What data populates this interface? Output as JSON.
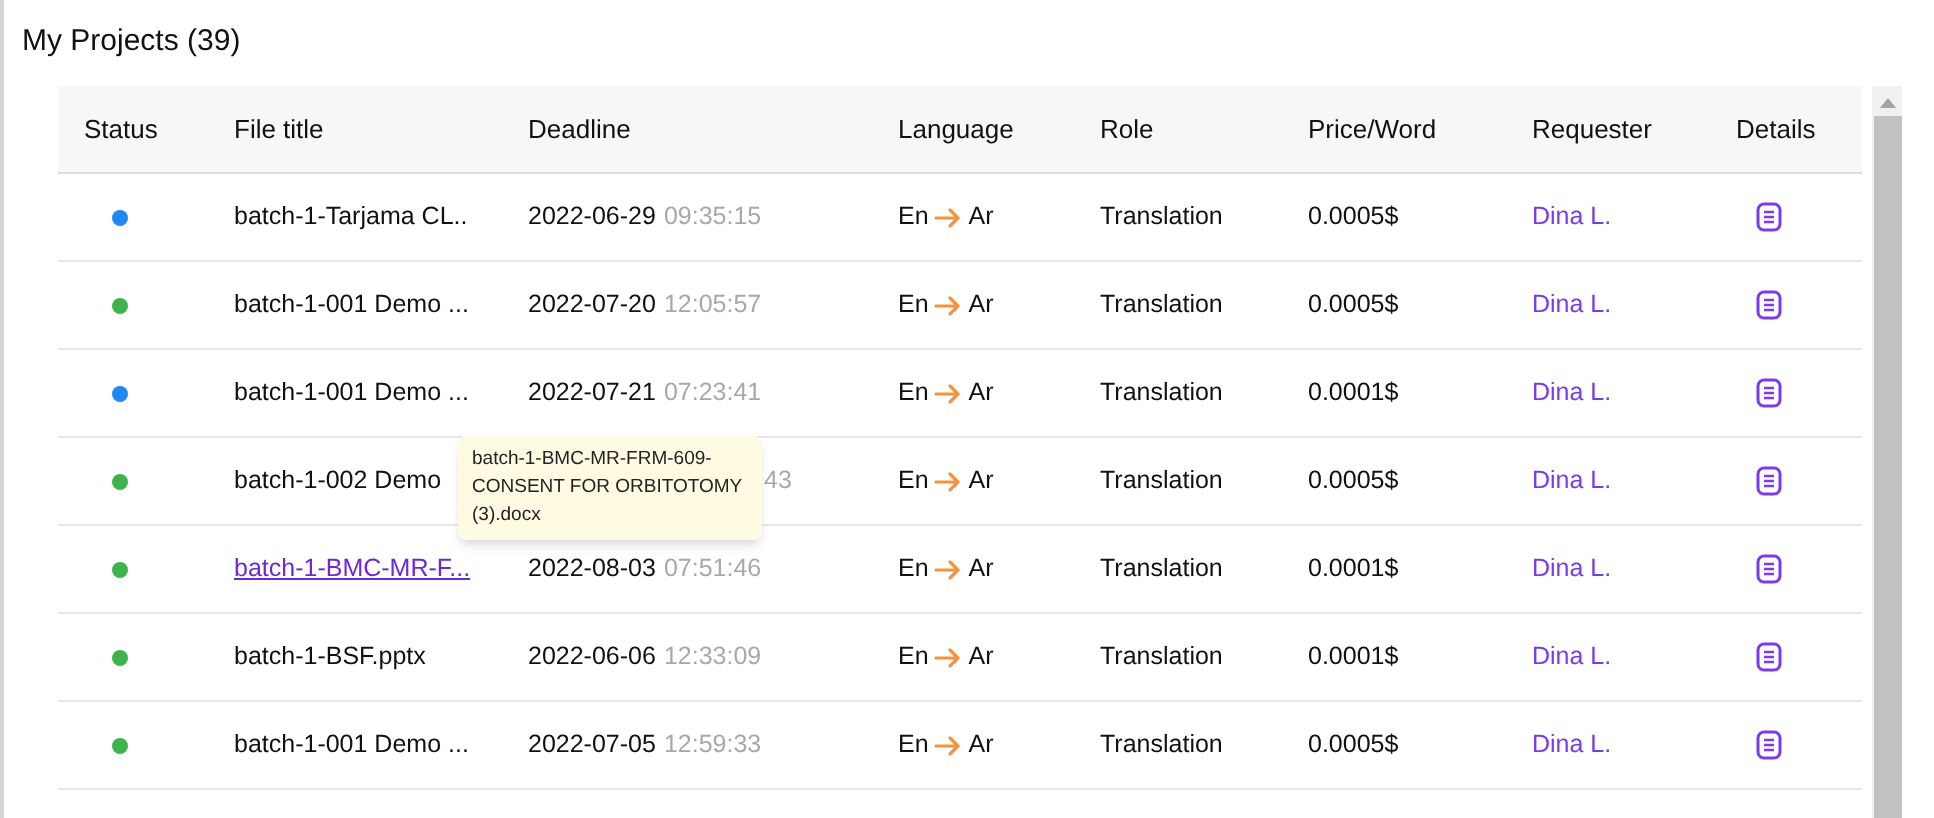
{
  "title": "My Projects (39)",
  "columns": [
    "Status",
    "File title",
    "Deadline",
    "Language",
    "Role",
    "Price/Word",
    "Requester",
    "Details"
  ],
  "rows": [
    {
      "color": "#1e88f5",
      "file": "batch-1-Tarjama CL..",
      "link": false,
      "date": "2022-06-29",
      "time": "09:35:15",
      "source": "En",
      "target": "Ar",
      "role": "Translation",
      "price": "0.0005$",
      "requester": "Dina L."
    },
    {
      "color": "#3cb44b",
      "file": "batch-1-001 Demo ...",
      "link": false,
      "date": "2022-07-20",
      "time": "12:05:57",
      "source": "En",
      "target": "Ar",
      "role": "Translation",
      "price": "0.0005$",
      "requester": "Dina L."
    },
    {
      "color": "#1e88f5",
      "file": "batch-1-001 Demo ...",
      "link": false,
      "date": "2022-07-21",
      "time": "07:23:41",
      "source": "En",
      "target": "Ar",
      "role": "Translation",
      "price": "0.0001$",
      "requester": "Dina L."
    },
    {
      "color": "#3cb44b",
      "file": "batch-1-002 Demo",
      "link": false,
      "time": "43",
      "source": "En",
      "target": "Ar",
      "role": "Translation",
      "price": "0.0005$",
      "requester": "Dina L."
    },
    {
      "color": "#3cb44b",
      "file": "batch-1-BMC-MR-F...",
      "link": true,
      "date": "2022-08-03",
      "time": "07:51:46",
      "source": "En",
      "target": "Ar",
      "role": "Translation",
      "price": "0.0001$",
      "requester": "Dina L."
    },
    {
      "color": "#3cb44b",
      "file": "batch-1-BSF.pptx",
      "link": false,
      "date": "2022-06-06",
      "time": "12:33:09",
      "source": "En",
      "target": "Ar",
      "role": "Translation",
      "price": "0.0001$",
      "requester": "Dina L."
    },
    {
      "color": "#3cb44b",
      "file": "batch-1-001 Demo ...",
      "link": false,
      "date": "2022-07-05",
      "time": "12:59:33",
      "source": "En",
      "target": "Ar",
      "role": "Translation",
      "price": "0.0005$",
      "requester": "Dina L."
    }
  ],
  "tooltip": "batch-1-BMC-MR-FRM-609-CONSENT FOR ORBITOTOMY (3).docx"
}
